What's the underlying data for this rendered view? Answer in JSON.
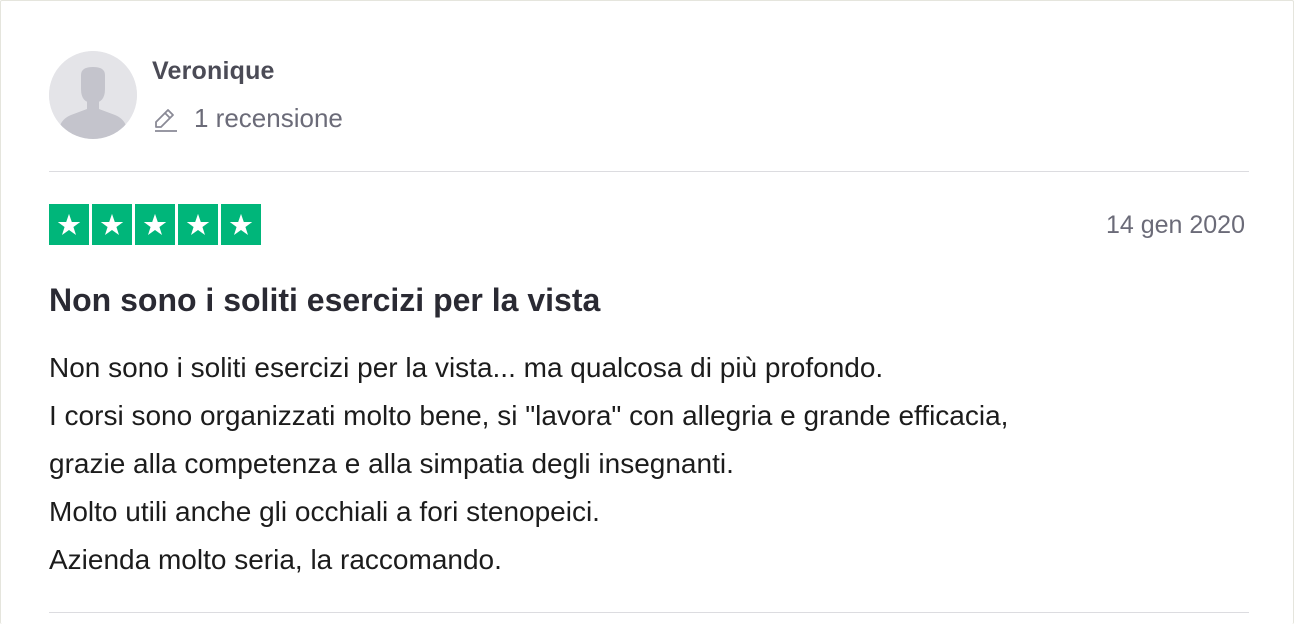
{
  "reviewer": {
    "name": "Veronique",
    "review_count": "1 recensione",
    "avatar_icon": "user-silhouette-icon",
    "count_icon": "pencil-icon"
  },
  "rating": {
    "stars": 5,
    "max_stars": 5,
    "star_color": "#00b67a",
    "star_icon": "star-icon"
  },
  "review": {
    "date": "14 gen 2020",
    "title": "Non sono i soliti esercizi per la vista",
    "body_lines": [
      "Non sono i soliti esercizi per la vista... ma qualcosa di più profondo.",
      "I corsi sono organizzati molto bene, si \"lavora\" con allegria e grande efficacia,",
      "grazie alla competenza e alla simpatia degli insegnanti.",
      "Molto utili anche gli occhiali a fori stenopeici.",
      "Azienda molto seria, la raccomando."
    ]
  }
}
